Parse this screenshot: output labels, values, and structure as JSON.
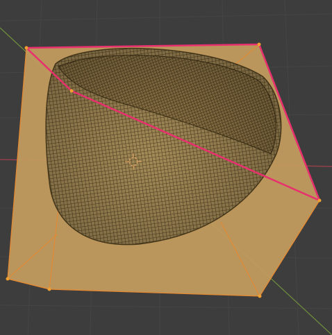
{
  "viewport": {
    "background_color": "#3d3d3d",
    "grid_color": "#454545",
    "x_axis_color": "#a2404c",
    "y_axis_color": "#6f8f3c"
  },
  "object": {
    "cage_face_color": "#c49c5e",
    "cage_edge_color": "#e8892f",
    "selected_edge_color": "#e8306e",
    "vertex_color": "#f0a030",
    "mesh_wire_color": "#4c3c1c",
    "mesh_fill_color": "#a38a58",
    "mesh_rim_color": "#8a7346"
  },
  "origin": {
    "icon": "3d-cursor-icon",
    "cursor_color": "#d8a060"
  }
}
